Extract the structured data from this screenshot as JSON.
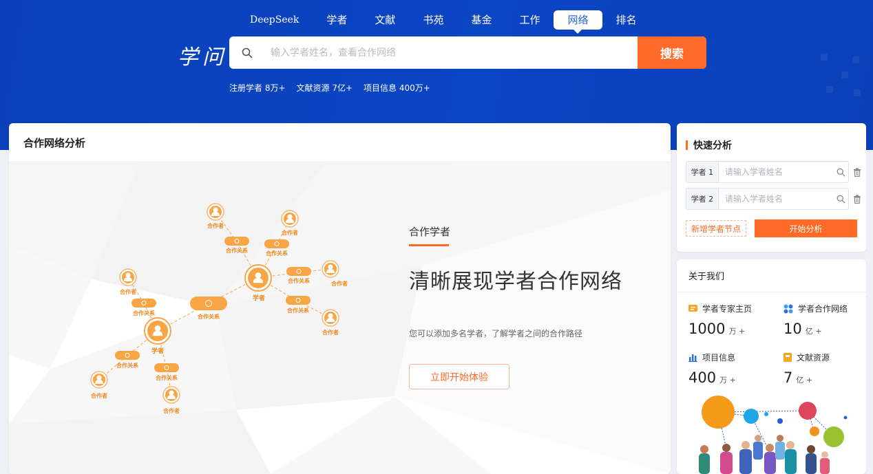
{
  "nav": {
    "items": [
      {
        "label": "DeepSeek",
        "active": false
      },
      {
        "label": "学者",
        "active": false
      },
      {
        "label": "文献",
        "active": false
      },
      {
        "label": "书苑",
        "active": false
      },
      {
        "label": "基金",
        "active": false
      },
      {
        "label": "工作",
        "active": false
      },
      {
        "label": "网络",
        "active": true
      },
      {
        "label": "排名",
        "active": false
      }
    ]
  },
  "logo": {
    "text": "学问"
  },
  "search": {
    "placeholder": "输入学者姓名，查看合作网络",
    "button_label": "搜索"
  },
  "stats": [
    "注册学者 8万+",
    "文献资源 7亿+",
    "项目信息 400万+"
  ],
  "main": {
    "title": "合作网络分析",
    "network": {
      "labels": {
        "scholar": "学者",
        "collaborator": "合作者",
        "relation": "合作关系"
      }
    },
    "intro": {
      "tag": "合作学者",
      "heading": "清晰展现学者合作网络",
      "description": "您可以添加多名学者，了解学者之间的合作路径",
      "button_label": "立即开始体验"
    }
  },
  "quick": {
    "title": "快速分析",
    "rows": [
      {
        "label": "学者 1",
        "placeholder": "请输入学者姓名"
      },
      {
        "label": "学者 2",
        "placeholder": "请输入学者姓名"
      }
    ],
    "add_label": "新增学者节点",
    "start_label": "开始分析"
  },
  "about": {
    "title": "关于我们",
    "stats": [
      {
        "label": "学者专家主页",
        "value": "1000",
        "unit": "万 +",
        "icon": "homepage-icon"
      },
      {
        "label": "学者合作网络",
        "value": "10",
        "unit": "亿 +",
        "icon": "network-icon"
      },
      {
        "label": "项目信息",
        "value": "400",
        "unit": "万 +",
        "icon": "chart-icon"
      },
      {
        "label": "文献资源",
        "value": "7",
        "unit": "亿 +",
        "icon": "document-icon"
      }
    ]
  },
  "colors": {
    "header_blue": "#0b42bf",
    "accent_orange": "#ff6a26",
    "node_orange": "#f7a545",
    "active_tab_text": "#2a63e0"
  }
}
